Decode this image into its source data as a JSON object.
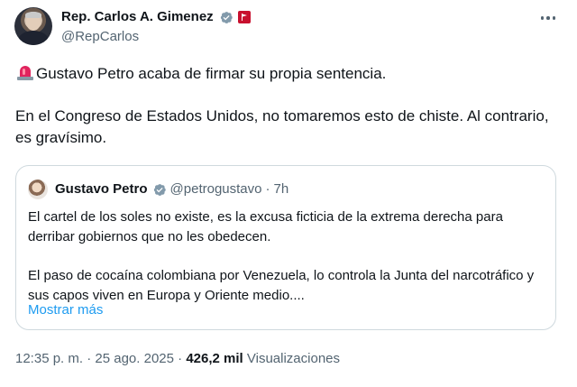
{
  "author": {
    "display_name": "Rep. Carlos A. Gimenez",
    "handle": "@RepCarlos",
    "verified_icon": "verified-badge-icon",
    "affiliation_icon": "government-flag-icon"
  },
  "tweet": {
    "paragraphs": [
      "Gustavo Petro acaba de firmar su propia sentencia.",
      "En el Congreso de Estados Unidos, no tomaremos esto de chiste. Al contrario, es gravísimo."
    ],
    "leading_emoji": "police-siren-icon"
  },
  "quoted_tweet": {
    "display_name": "Gustavo Petro",
    "handle": "@petrogustavo",
    "separator": "·",
    "time": "7h",
    "paragraphs": [
      "El cartel de los soles no existe, es la excusa ficticia de la extrema derecha para derribar gobiernos que no les obedecen.",
      "El paso de cocaína colombiana por Venezuela, lo controla la Junta del narcotráfico y sus capos viven en Europa y Oriente medio...."
    ],
    "show_more_label": "Mostrar más"
  },
  "meta": {
    "time": "12:35 p. m.",
    "separator": "·",
    "date": "25 ago. 2025",
    "views_count": "426,2 mil",
    "views_label": "Visualizaciones"
  },
  "colors": {
    "text_primary": "#0f1419",
    "text_secondary": "#536471",
    "link": "#1d9bf0",
    "verified": "#1d9bf0",
    "border": "#cfd9de",
    "siren_red": "#e0245e"
  }
}
